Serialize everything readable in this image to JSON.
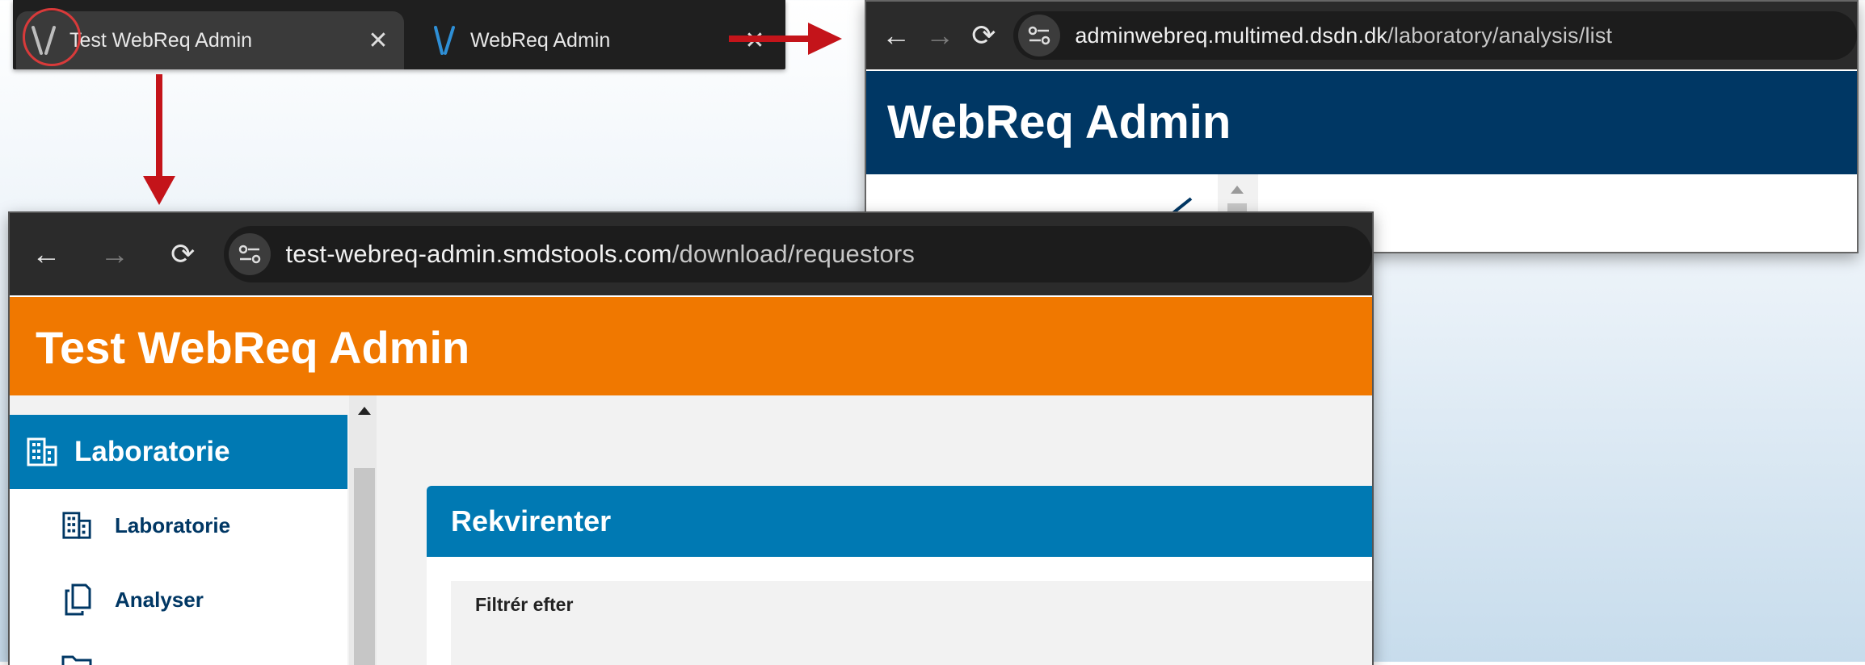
{
  "tabs": [
    {
      "title": "Test WebReq Admin",
      "close": "✕",
      "active": true
    },
    {
      "title": "WebReq Admin",
      "close": "✕",
      "active": false
    }
  ],
  "prod_window": {
    "url_host": "adminwebreq.multimed.dsdn.dk",
    "url_path": "/laboratory/analysis/list",
    "app_title": "WebReq Admin",
    "header_color": "#003764"
  },
  "test_window": {
    "url_host": "test-webreq-admin.smdstools.com",
    "url_path": "/download/requestors",
    "app_title": "Test WebReq Admin",
    "header_color": "#f07800",
    "sidebar": {
      "section": "Laboratorie",
      "items": [
        {
          "label": "Laboratorie",
          "icon": "building-icon"
        },
        {
          "label": "Analyser",
          "icon": "copy-icon"
        }
      ]
    },
    "card": {
      "title": "Rekvirenter",
      "filter_label": "Filtrér efter"
    }
  },
  "colors": {
    "arrow": "#c4141a",
    "accent_blue": "#0079b3",
    "highlight_ring": "#d83a3a"
  }
}
